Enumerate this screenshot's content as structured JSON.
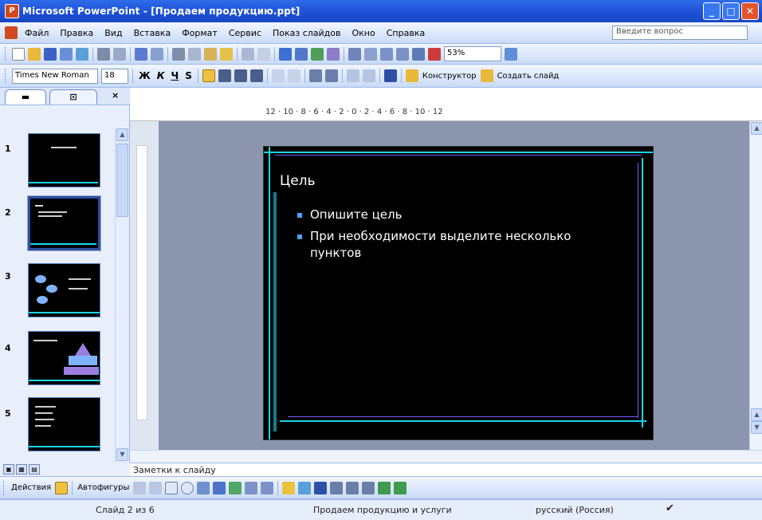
{
  "window": {
    "title": "Microsoft PowerPoint - [Продаем продукцию.ppt]",
    "buttons": [
      "_",
      "□",
      "✕"
    ],
    "colors": {
      "titlebar": "#1c4fd6",
      "toolbar": "#c9dbf7",
      "slide_bg": "#000000",
      "accent_cyan": "#19d6e8",
      "accent_purple": "#7b5cff",
      "canvas": "#8b95ad"
    }
  },
  "menubar": {
    "items": [
      "Файл",
      "Правка",
      "Вид",
      "Вставка",
      "Формат",
      "Сервис",
      "Показ слайдов",
      "Окно",
      "Справка"
    ],
    "help_placeholder": "Введите вопрос"
  },
  "toolbar_standard": {
    "zoom": "53%"
  },
  "toolbar_format": {
    "font": "Times New Roman",
    "size": "18",
    "bold": "Ж",
    "italic": "К",
    "underline": "Ч",
    "shadow": "S",
    "design_label": "Конструктор",
    "new_slide_label": "Создать слайд"
  },
  "left_pane": {
    "tabs": [
      "▬",
      "⊡"
    ],
    "close": "×",
    "slides": [
      {
        "num": "1"
      },
      {
        "num": "2",
        "selected": true
      },
      {
        "num": "3"
      },
      {
        "num": "4"
      },
      {
        "num": "5"
      }
    ]
  },
  "ruler": {
    "text": "12 · 10 · 8 · 6 · 4 · 2 · 0 · 2 · 4 · 6 · 8 · 10 · 12"
  },
  "slide": {
    "title": "Цель",
    "bullets": [
      "Опишите цель",
      "При необходимости выделите несколько пунктов"
    ]
  },
  "notes": {
    "placeholder": "Заметки к слайду"
  },
  "drawing_toolbar": {
    "draw_label": "Действия",
    "autoshapes_label": "Автофигуры"
  },
  "statusbar": {
    "slide_info": "Слайд 2 из 6",
    "design": "Продаем продукцию и услуги",
    "language": "русский (Россия)"
  }
}
